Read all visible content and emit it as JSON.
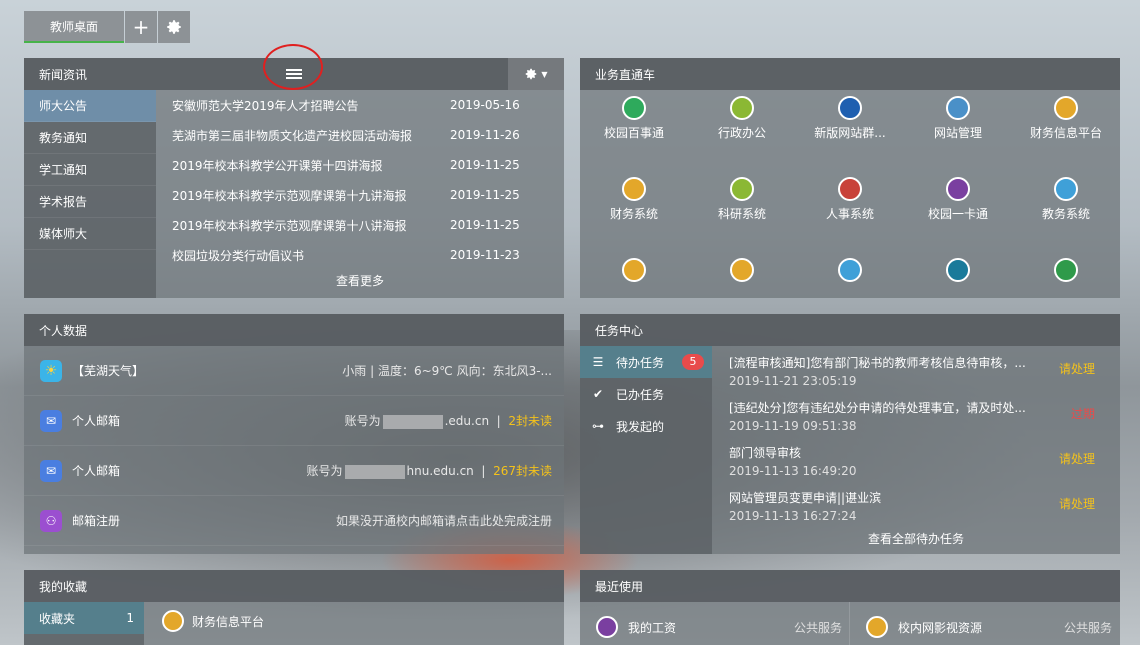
{
  "tabs": {
    "desk": "教师桌面"
  },
  "news": {
    "title": "新闻资讯",
    "categories": [
      "师大公告",
      "教务通知",
      "学工通知",
      "学术报告",
      "媒体师大"
    ],
    "items": [
      {
        "title": "安徽师范大学2019年人才招聘公告",
        "date": "2019-05-16"
      },
      {
        "title": "芜湖市第三届非物质文化遗产进校园活动海报",
        "date": "2019-11-26"
      },
      {
        "title": "2019年校本科教学公开课第十四讲海报",
        "date": "2019-11-25"
      },
      {
        "title": "2019年校本科教学示范观摩课第十九讲海报",
        "date": "2019-11-25"
      },
      {
        "title": "2019年校本科教学示范观摩课第十八讲海报",
        "date": "2019-11-25"
      },
      {
        "title": "校园垃圾分类行动倡议书",
        "date": "2019-11-23"
      }
    ],
    "more": "查看更多"
  },
  "biz": {
    "title": "业务直通车",
    "apps": [
      {
        "label": "校园百事通",
        "color": "#2eaa5c"
      },
      {
        "label": "行政办公",
        "color": "#8bb834"
      },
      {
        "label": "新版网站群...",
        "color": "#1f5fb0"
      },
      {
        "label": "网站管理",
        "color": "#4a90c8"
      },
      {
        "label": "财务信息平台",
        "color": "#e3a72a"
      },
      {
        "label": "财务系统",
        "color": "#e3a72a"
      },
      {
        "label": "科研系统",
        "color": "#8bb834"
      },
      {
        "label": "人事系统",
        "color": "#c8423a"
      },
      {
        "label": "校园一卡通",
        "color": "#7a3fa0"
      },
      {
        "label": "教务系统",
        "color": "#3fa0d8"
      },
      {
        "label": "",
        "color": "#e3a72a"
      },
      {
        "label": "",
        "color": "#e3a72a"
      },
      {
        "label": "",
        "color": "#3fa0d8"
      },
      {
        "label": "",
        "color": "#1a7a9a"
      },
      {
        "label": "",
        "color": "#2f9a4a"
      }
    ]
  },
  "personal": {
    "title": "个人数据",
    "weather": {
      "label": "【芜湖天气】",
      "info": "小雨  |  温度：6~9℃ 风向：东北风3-..."
    },
    "mail1": {
      "label": "个人邮箱",
      "account": "账号为",
      "domain": ".edu.cn",
      "unread": "2封未读"
    },
    "mail2": {
      "label": "个人邮箱",
      "account": "账号为",
      "domain": "hnu.edu.cn",
      "unread": "267封未读"
    },
    "reg": {
      "label": "邮箱注册",
      "link": "如果没开通校内邮箱请点击此处完成注册"
    }
  },
  "task": {
    "title": "任务中心",
    "side": [
      {
        "label": "待办任务",
        "badge": "5"
      },
      {
        "label": "已办任务"
      },
      {
        "label": "我发起的"
      }
    ],
    "items": [
      {
        "title": "[流程审核通知]您有部门秘书的教师考核信息待审核，...",
        "time": "2019-11-21 23:05:19",
        "status": "请处理"
      },
      {
        "title": "[违纪处分]您有违纪处分申请的待处理事宜，请及时处...",
        "time": "2019-11-19 09:51:38",
        "status": "过期"
      },
      {
        "title": "部门领导审核",
        "time": "2019-11-13 16:49:20",
        "status": "请处理"
      },
      {
        "title": "网站管理员变更申请||谌业滨",
        "time": "2019-11-13 16:27:24",
        "status": "请处理"
      }
    ],
    "more": "查看全部待办任务"
  },
  "fav": {
    "title": "我的收藏",
    "folder": "收藏夹",
    "count": "1",
    "item": "财务信息平台"
  },
  "recent": {
    "title": "最近使用",
    "items": [
      {
        "name": "我的工资",
        "cat": "公共服务"
      },
      {
        "name": "校内网影视资源",
        "cat": "公共服务"
      }
    ]
  }
}
